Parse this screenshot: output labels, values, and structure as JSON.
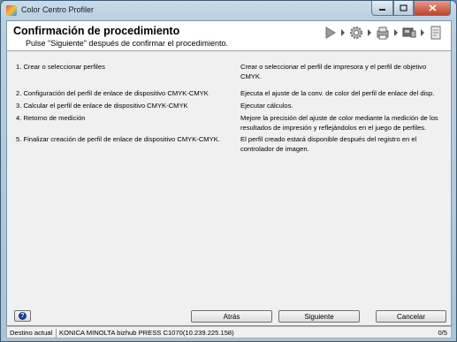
{
  "window": {
    "title": "Color Centro Profiler"
  },
  "header": {
    "title": "Confirmación de procedimiento",
    "subtitle": "Pulse \"Siguiente\" después de confirmar el procedimiento.",
    "wizard_icons": [
      "play-icon",
      "gear-icon",
      "printer-icon",
      "scanner-icon",
      "document-icon"
    ]
  },
  "procedure": [
    {
      "step": "1. Crear o seleccionar perfiles",
      "description": "Crear o seleccionar el perfil de impresora y el perfil de objetivo CMYK."
    },
    {
      "step": "2. Configuración del perfil de enlace de dispositivo CMYK-CMYK",
      "description": "Ejecuta el ajuste de la conv. de color del perfil de enlace del disp."
    },
    {
      "step": "3. Calcular el perfil de enlace de dispositivo CMYK-CMYK",
      "description": "Ejecutar cálculos."
    },
    {
      "step": "4. Retorno de medición",
      "description": "Mejore la precisión del ajuste de color mediante la medición de los resultados de impresión y reflejándolos en el juego de perfiles."
    },
    {
      "step": "5. Finalizar creación de perfil de enlace de dispositivo CMYK-CMYK.",
      "description": "El perfil creado estará disponible después del registro en el controlador de imagen."
    }
  ],
  "buttons": {
    "back": "Atrás",
    "next": "Siguiente",
    "cancel": "Cancelar"
  },
  "status": {
    "label": "Destino actual",
    "device": "KONICA MINOLTA bizhub PRESS C1070(10.239.225.158)",
    "count": "0/5"
  }
}
